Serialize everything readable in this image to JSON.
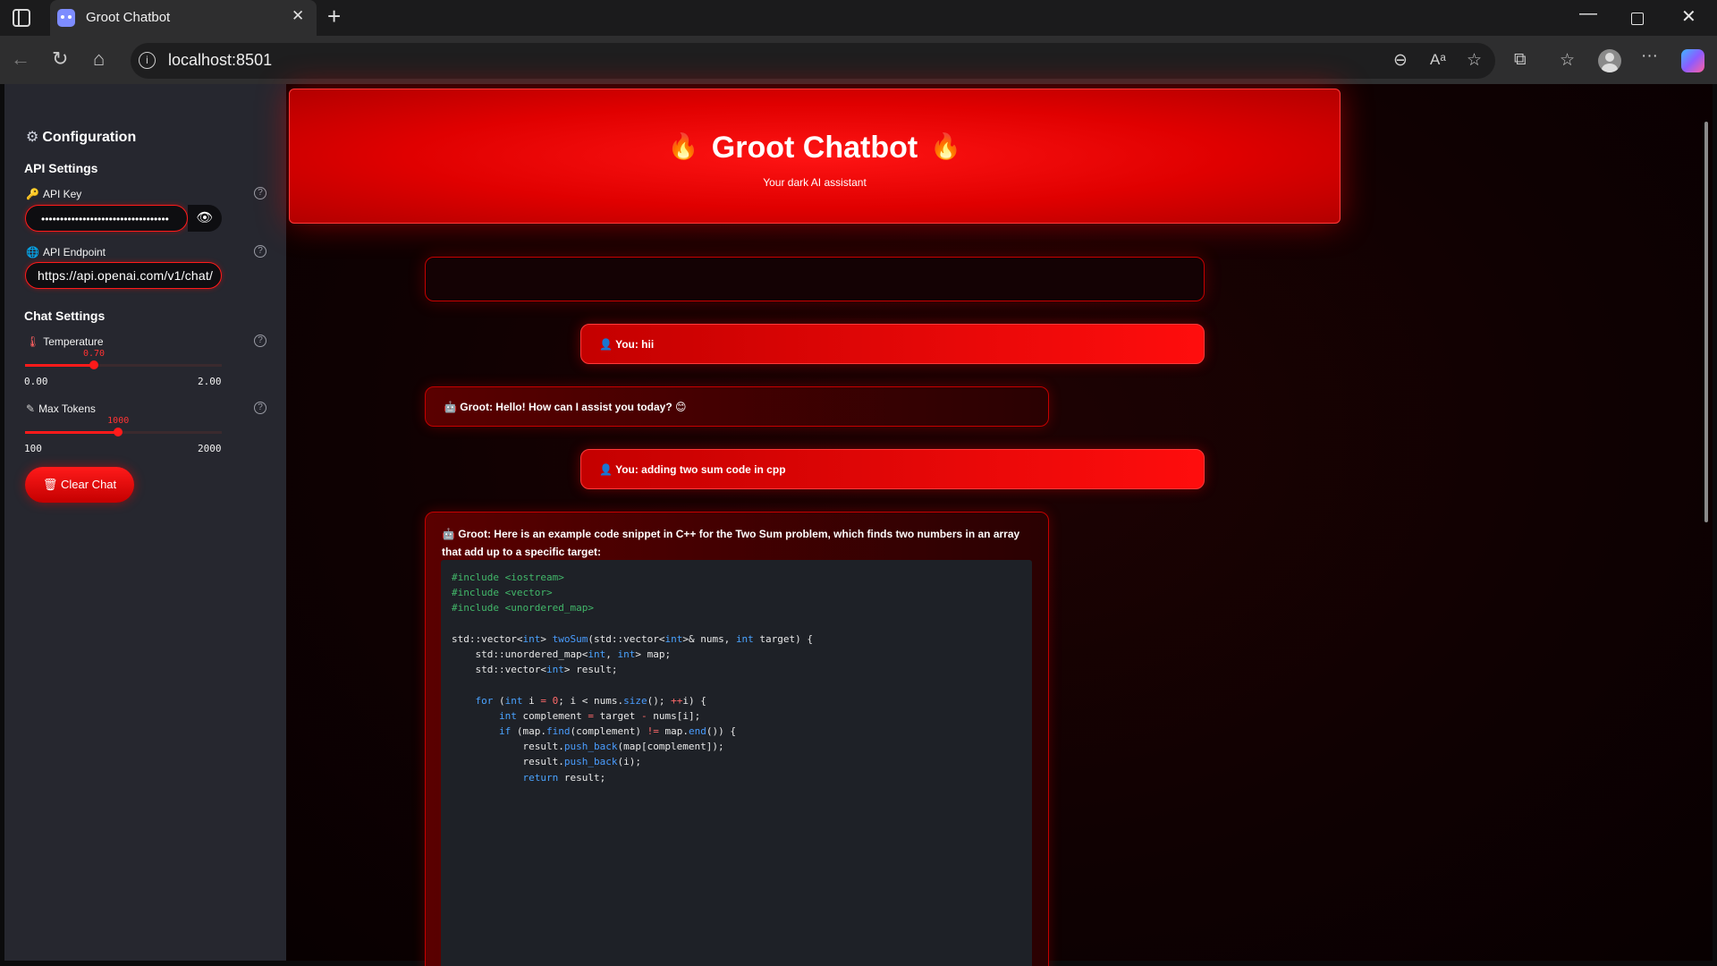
{
  "browser": {
    "tab_title": "Groot Chatbot",
    "url": "localhost:8501"
  },
  "sidebar": {
    "title": "Configuration",
    "api_settings_heading": "API Settings",
    "api_key_label": "API Key",
    "api_key_value": "••••••••••••••••••••••••••••••••••",
    "api_endpoint_label": "API Endpoint",
    "api_endpoint_value": "https://api.openai.com/v1/chat/",
    "chat_settings_heading": "Chat Settings",
    "temperature": {
      "label": "Temperature",
      "value": "0.70",
      "min": "0.00",
      "max": "2.00",
      "fraction": 0.35
    },
    "max_tokens": {
      "label": "Max Tokens",
      "value": "1000",
      "min": "100",
      "max": "2000",
      "fraction": 0.4737
    },
    "clear_button": "Clear Chat"
  },
  "header": {
    "title": "Groot Chatbot",
    "subtitle": "Your dark AI assistant"
  },
  "messages": [
    {
      "role": "user",
      "text": "You: hii"
    },
    {
      "role": "bot",
      "text": "Groot: Hello! How can I assist you today? 😊"
    },
    {
      "role": "user",
      "text": "You: adding two sum code in cpp"
    },
    {
      "role": "bot",
      "text": "Groot: Here is an example code snippet in C++ for the Two Sum problem, which finds two numbers in an array that add up to a specific target:"
    }
  ],
  "code_lines": [
    "#include <iostream>",
    "#include <vector>",
    "#include <unordered_map>",
    "",
    "std::vector<int> twoSum(std::vector<int>& nums, int target) {",
    "    std::unordered_map<int, int> map;",
    "    std::vector<int> result;",
    "",
    "    for (int i = 0; i < nums.size(); ++i) {",
    "        int complement = target - nums[i];",
    "        if (map.find(complement) != map.end()) {",
    "            result.push_back(map[complement]);",
    "            result.push_back(i);",
    "            return result;"
  ],
  "colors": {
    "accent": "#ff1a1a",
    "sidebar_bg": "#26272f",
    "main_bg": "#0f0102",
    "code_bg": "#1e2127"
  }
}
